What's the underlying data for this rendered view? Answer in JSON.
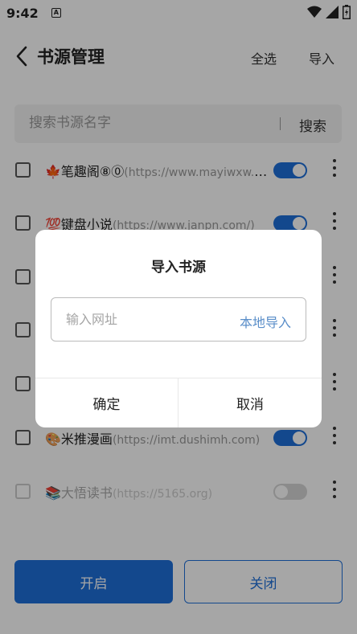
{
  "status": {
    "time": "9:42",
    "notification": "A"
  },
  "header": {
    "title": "书源管理",
    "select_all": "全选",
    "import": "导入"
  },
  "search": {
    "placeholder": "搜索书源名字",
    "button": "搜索"
  },
  "sources": [
    {
      "emoji": "🍁",
      "name": "笔趣阁⑧⓪",
      "url": "(https://www.mayiwxw.c...",
      "enabled": true
    },
    {
      "emoji": "💯",
      "name": "键盘小说",
      "url": "(https://www.janpn.com/)",
      "enabled": true
    },
    {
      "emoji": "",
      "name": "",
      "url": "",
      "enabled": true
    },
    {
      "emoji": "",
      "name": "",
      "url": "",
      "enabled": true
    },
    {
      "emoji": "",
      "name": "",
      "url": "",
      "enabled": true
    },
    {
      "emoji": "🎨",
      "name": "米推漫画",
      "url": "(https://imt.dushimh.com)",
      "enabled": true
    },
    {
      "emoji": "📚",
      "name": "大悟读书",
      "url": "(https://5165.org)",
      "enabled": false
    }
  ],
  "footer": {
    "open": "开启",
    "close": "关闭"
  },
  "dialog": {
    "title": "导入书源",
    "url_placeholder": "输入网址",
    "local_import": "本地导入",
    "confirm": "确定",
    "cancel": "取消"
  },
  "colors": {
    "accent": "#1e6fd9",
    "link": "#5a8ec9"
  }
}
